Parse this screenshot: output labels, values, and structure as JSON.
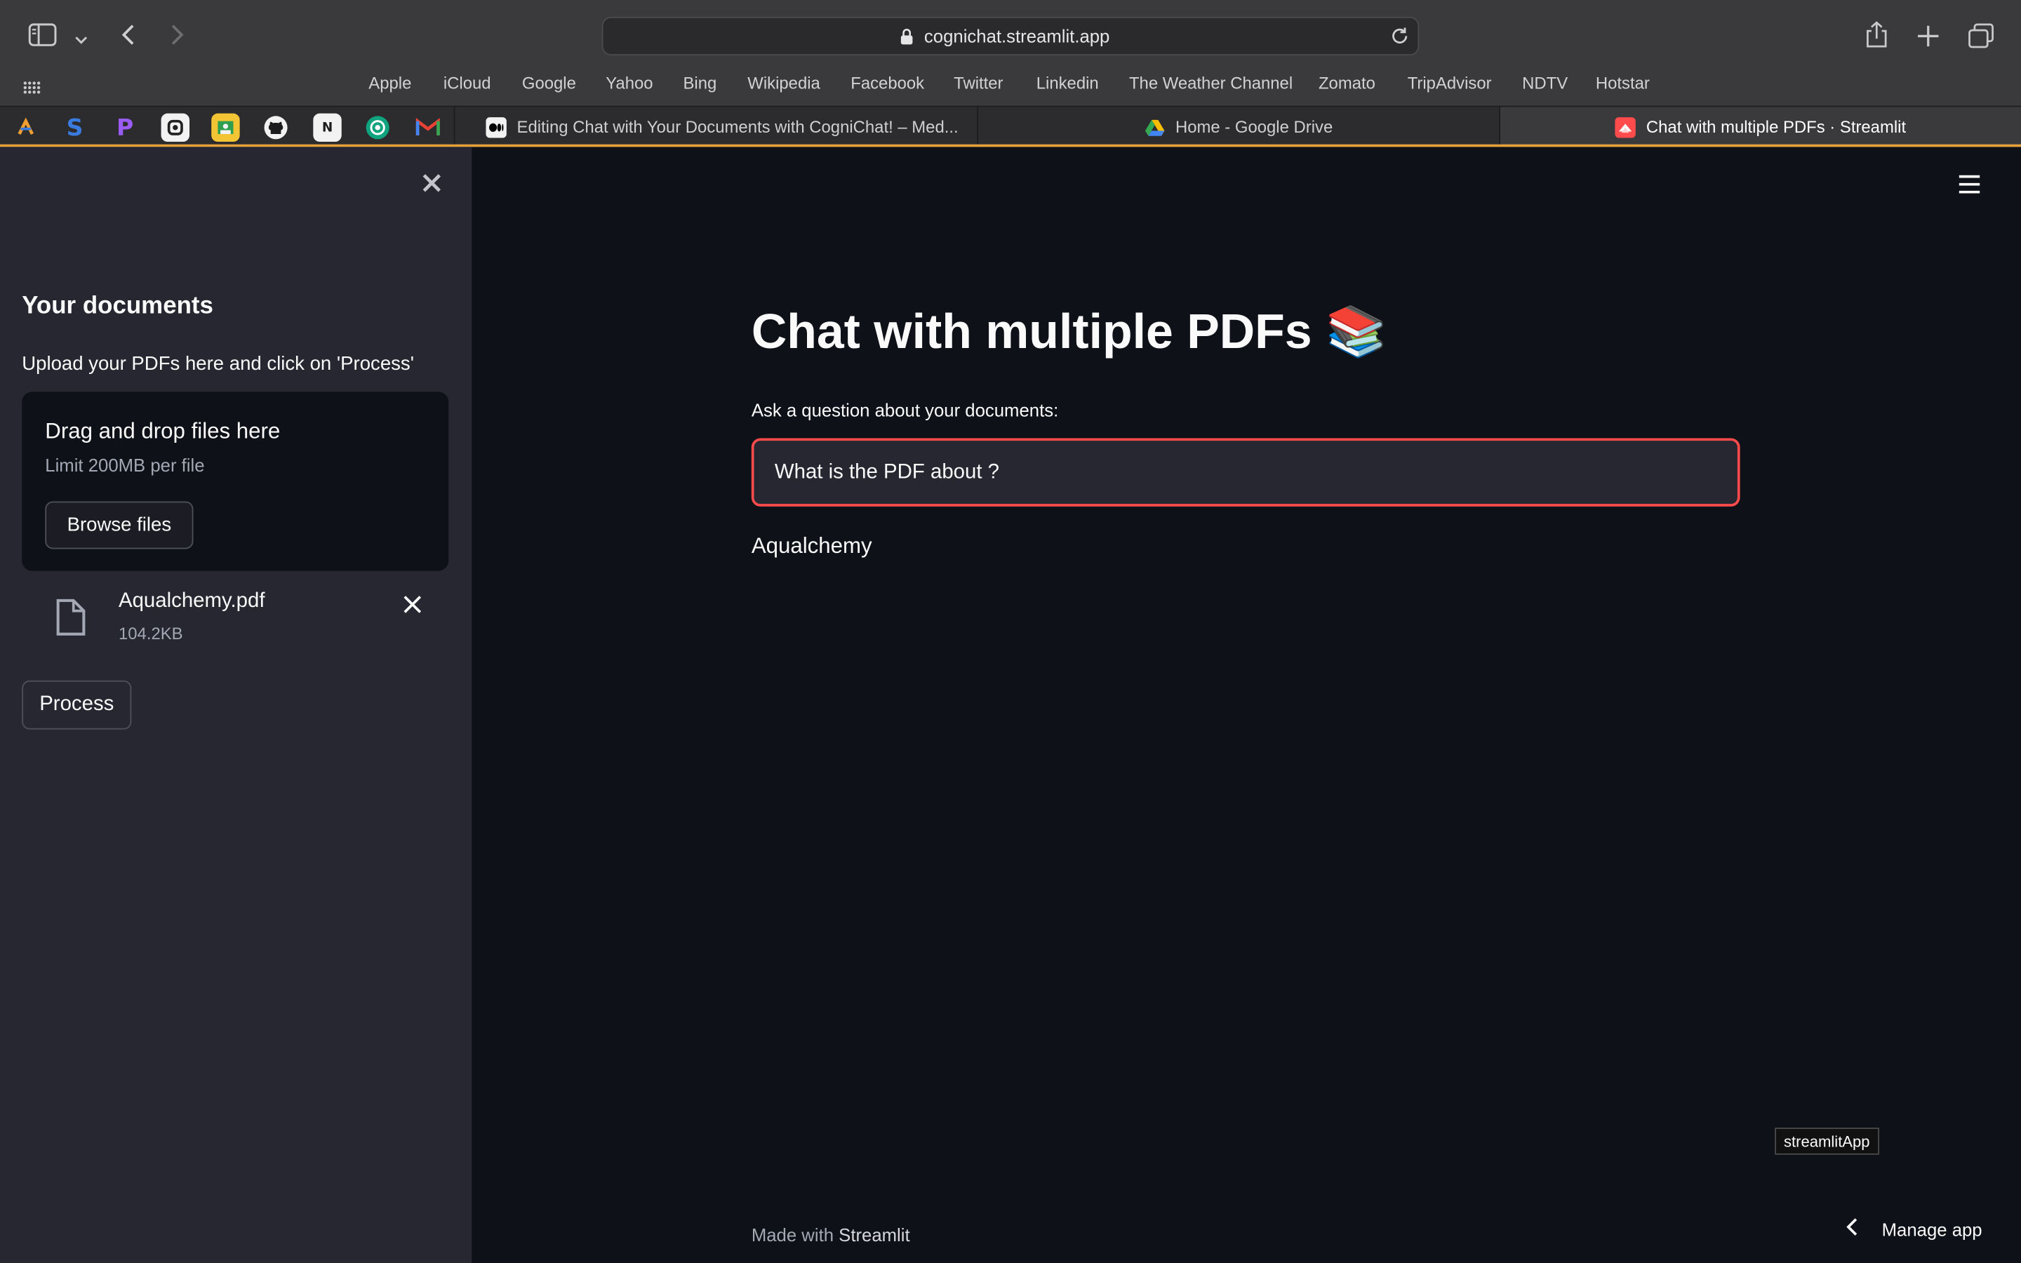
{
  "browser": {
    "url": "cognichat.streamlit.app",
    "favorites": [
      "Apple",
      "iCloud",
      "Google",
      "Yahoo",
      "Bing",
      "Wikipedia",
      "Facebook",
      "Twitter",
      "Linkedin",
      "The Weather Channel",
      "Zomato",
      "TripAdvisor",
      "NDTV",
      "Hotstar"
    ],
    "tabs": [
      {
        "title": "Editing Chat with Your Documents with CogniChat! – Med..."
      },
      {
        "title": "Home - Google Drive"
      },
      {
        "title": "Chat with multiple PDFs · Streamlit"
      }
    ],
    "pinned_icons": [
      "colorful-logo-icon",
      "s-logo-icon",
      "p-logo-icon",
      "slack-like-icon",
      "photos-icon",
      "github-icon",
      "hn-icon",
      "chatgpt-icon",
      "gmail-icon"
    ]
  },
  "sidebar": {
    "heading": "Your documents",
    "subtitle": "Upload your PDFs here and click on 'Process'",
    "dropzone_title": "Drag and drop files here",
    "dropzone_limit": "Limit 200MB per file",
    "browse_label": "Browse files",
    "file": {
      "name": "Aqualchemy.pdf",
      "size": "104.2KB"
    },
    "process_label": "Process"
  },
  "main": {
    "title": "Chat with multiple PDFs 📚",
    "question_label": "Ask a question about your documents:",
    "question_value": "What is the PDF about ?",
    "answer": "Aqualchemy",
    "tooltip": "streamlitApp",
    "footer_prefix": "Made with",
    "footer_brand": "Streamlit",
    "manage_label": "Manage app"
  },
  "colors": {
    "accent": "#ff4b4b",
    "sidebar_bg": "#262730",
    "main_bg": "#0e1117",
    "tab_accent": "#e8a13a"
  }
}
